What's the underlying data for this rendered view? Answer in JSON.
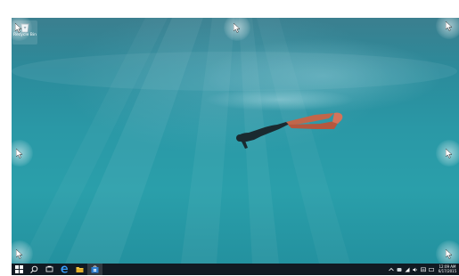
{
  "desktop": {
    "wallpaper": "underwater-freediver",
    "icons": [
      {
        "label": "Recycle Bin",
        "icon": "recycle-bin-icon"
      }
    ],
    "hot_corner_cursors": 8
  },
  "taskbar": {
    "pinned": [
      "start-icon",
      "search-icon",
      "task-view-icon",
      "edge-icon",
      "file-explorer-icon",
      "store-icon"
    ],
    "tray": {
      "time": "12:09 AM",
      "date": "6/17/2015"
    }
  },
  "colors": {
    "taskbar": "#111a22",
    "water_top": "#3b7f8f",
    "water_bottom": "#23919f",
    "edge_blue": "#1e90ff"
  }
}
